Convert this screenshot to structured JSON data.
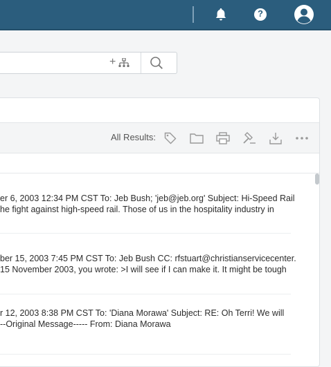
{
  "topbar": {
    "icons": [
      "bell-icon",
      "help-icon",
      "account-icon"
    ],
    "help_glyph": "?",
    "color": "#2b5d7d"
  },
  "search": {
    "plus_glyph": "+",
    "icons": [
      "hierarchy-icon",
      "search-icon"
    ]
  },
  "toolbar": {
    "all_results_label": "All Results:",
    "icons": [
      "tag-icon",
      "folder-icon",
      "print-icon",
      "gavel-icon",
      "download-icon",
      "more-icon"
    ]
  },
  "results": [
    {
      "line1": "er 6, 2003 12:34 PM CST To: Jeb Bush; 'jeb@jeb.org' Subject: Hi-Speed Rail",
      "line2": "he fight against high-speed rail. Those of us in the hospitality industry in"
    },
    {
      "line1": "ber 15, 2003 7:45 PM CST To: Jeb Bush CC: rfstuart@christianservicecenter.",
      "line2": "15 November 2003, you wrote: >I will see if I can make it. It might be tough"
    },
    {
      "line1": "r 12, 2003 8:38 PM CST To: 'Diana Morawa' Subject: RE: Oh Terri! We will",
      "line2": "--Original Message----- From: Diana Morawa"
    }
  ]
}
